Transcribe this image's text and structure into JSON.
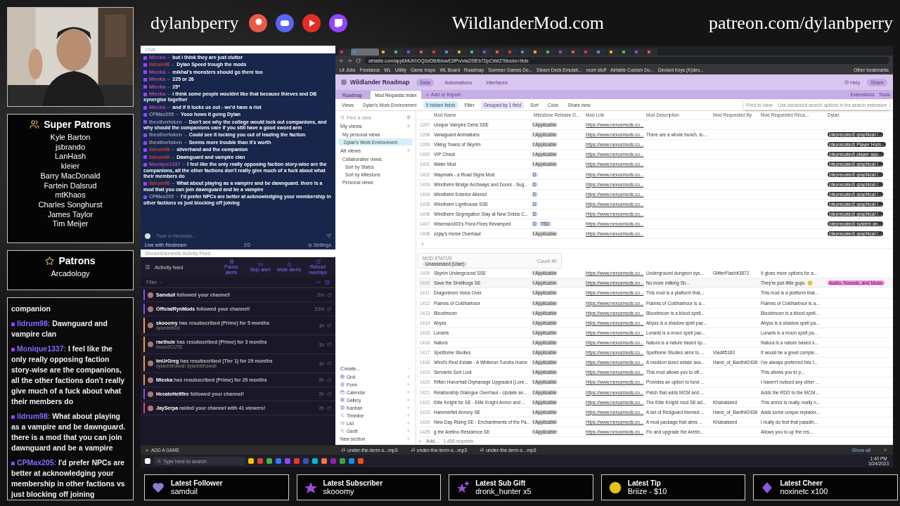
{
  "super_patrons": {
    "title": "Super Patrons",
    "names": [
      "Kyle Barton",
      "jsbrando",
      "LanHash",
      "kleier",
      "Barry MacDonald",
      "Fartein Dalsrud",
      "mtKhaos",
      "Charles Songhurst",
      "James Taylor",
      "Tim Meijer"
    ]
  },
  "patrons": {
    "title": "Patrons",
    "names": [
      "Arcadology"
    ]
  },
  "overlay_chat": [
    {
      "text": "companion"
    },
    {
      "user": "lldrum98:",
      "text": "Dawnguard and vampire clan"
    },
    {
      "user": "Monique1337:",
      "text": "I feel like the only really opposing faction story-wise are the companions, all the other factions don't really give much of a fuck about what their members do"
    },
    {
      "user": "lldrum98:",
      "text": "What about playing as a vampire and be dawnguard. there is a mod that you can join dawnguard and be a vampire"
    },
    {
      "user": "CPMax205:",
      "text": "I'd prefer NPCs are better at acknowledging your membership in other factions vs just blocking off joining"
    }
  ],
  "header": {
    "channel": "dylanbperry",
    "site": "WildlanderMod.com",
    "patreon": "patreon.com/dylanbperry",
    "socials": [
      {
        "kind": "patreon"
      },
      {
        "kind": "discord"
      },
      {
        "kind": "youtube"
      },
      {
        "kind": "twitch"
      }
    ]
  },
  "restream": {
    "title": "Chat",
    "messages": [
      {
        "user": "Mieeka",
        "color": "#b04aa0",
        "text": "but i think they are just clutter"
      },
      {
        "user": "lldrum98",
        "color": "#d23c3c",
        "text": "Dylan Speed trough the mods"
      },
      {
        "user": "Mieeka",
        "color": "#b04aa0",
        "text": "mikhal's monsters should go there too"
      },
      {
        "user": "Mieeka",
        "color": "#b04aa0",
        "text": "225 or 26"
      },
      {
        "user": "Mieeka",
        "color": "#b04aa0",
        "text": "25*"
      },
      {
        "user": "Mieeka",
        "color": "#b04aa0",
        "text": "i think some people wouldnt like that because thieves and DB synergise together"
      },
      {
        "user": "Mieeka",
        "color": "#b04aa0",
        "text": "and if it locks us out - we'd have a riot"
      },
      {
        "user": "CPMax205",
        "color": "#9a9ab0",
        "text": "Yooo hows it going Dylan"
      },
      {
        "user": "theothertoken",
        "color": "#9a9ab0",
        "text": "Don't see why the college would lock out companions, and why should the companions care if you still have a good sword arm"
      },
      {
        "user": "theothertoken",
        "color": "#9a9ab0",
        "text": "Could see it locking you out of leading the faction"
      },
      {
        "user": "theothertoken",
        "color": "#9a9ab0",
        "text": "Seems more trouble than it's worth"
      },
      {
        "user": "lldrum98",
        "color": "#d23c3c",
        "text": "silverhand and the companion"
      },
      {
        "user": "lldrum98",
        "color": "#d23c3c",
        "text": "Dawnguard and vampire clan"
      },
      {
        "user": "Monique1337",
        "color": "#b04aa0",
        "text": "I feel like the only really opposing faction story-wise are the companions, all the other factions don't really give much of a fuck about what their members do"
      },
      {
        "user": "lldrum98",
        "color": "#d23c3c",
        "text": "What about playing as a vampire and be dawnguard. there is a mod that you can join dawnguard and be a vampire"
      },
      {
        "user": "CPMax205",
        "color": "#9a9ab0",
        "text": "I'd prefer NPCs are better at acknowledging your membership in other factions vs just blocking off joining"
      }
    ],
    "placeholder": "Type a message...",
    "live": "Live with Restream",
    "count": "2/2",
    "settings": "Settings"
  },
  "activity": {
    "window_title": "StreamElements Activity Feed",
    "title": "Activity feed",
    "actions": [
      "Pause alerts",
      "Skip alert",
      "Mute alerts",
      "Reload overlays"
    ],
    "filter": "Filter",
    "items": [
      {
        "user": "Samduil",
        "text": "followed your channel!",
        "time": "2m",
        "color": "#9146ff"
      },
      {
        "user": "OfficialRynMods",
        "text": "followed your channel!",
        "time": "53m",
        "color": "#9146ff"
      },
      {
        "user": "skooomy",
        "text": "has resubscribed (Prime) for 5 months",
        "sub": "dylanb6Kiol",
        "time": "1h",
        "color": "#e8a33c"
      },
      {
        "user": "raethule",
        "text": "has resubscribed (Prime) for 3 months",
        "sub": "moon2CUTE",
        "time": "1h",
        "color": "#e8a33c"
      },
      {
        "user": "ImUrGreg",
        "text": "has resubscribed (Tier 1) for 29 months",
        "sub": "dylanb6Kawaii dylanb6Kawaii",
        "time": "1h",
        "color": "#e8a33c"
      },
      {
        "user": "Mieeka",
        "text": "has resubscribed (Prime) for 26 months",
        "time": "2h",
        "color": "#e8a33c"
      },
      {
        "user": "HecateHellfire",
        "text": "followed your channel!",
        "time": "2h",
        "color": "#9146ff"
      },
      {
        "user": "JaySerpa",
        "text": "raided your channel with 41 viewers!",
        "time": "2h",
        "color": "#e0457b"
      }
    ],
    "add_game": "ADD A GAME"
  },
  "browser": {
    "tabs": [
      {
        "selected": false
      },
      {
        "selected": true
      },
      {
        "selected": false
      },
      {
        "selected": false
      },
      {
        "selected": false
      },
      {
        "selected": false
      },
      {
        "selected": false
      },
      {
        "selected": false
      },
      {
        "selected": false
      },
      {
        "selected": false
      },
      {
        "selected": false
      },
      {
        "selected": false
      },
      {
        "selected": false
      },
      {
        "selected": false
      },
      {
        "selected": false
      },
      {
        "selected": false
      },
      {
        "selected": false
      },
      {
        "selected": false
      },
      {
        "selected": false
      },
      {
        "selected": false
      },
      {
        "selected": false
      },
      {
        "selected": false
      },
      {
        "selected": false
      },
      {
        "selected": false
      }
    ],
    "address": "airtable.com/app6MUKhDQSdDB/tbluwE3fPn/viw2SfEb7DpCbMZ?blocks=hide",
    "bookmarks": [
      "Lit Jobs",
      "Freelance",
      "WL",
      "Utility",
      "Game Inspo",
      "WL Board",
      "Roadmap",
      "Summer Games Do...",
      "Steam Deck Emulati...",
      "room stuff",
      "Airtable Custom Do...",
      "Deviant Keys (K)dev..."
    ],
    "other_bookmarks": "Other bookmarks"
  },
  "airtable": {
    "base": "Wildlander Roadmap",
    "nav": [
      {
        "label": "Data",
        "selected": true
      },
      {
        "label": "Automations",
        "selected": false
      },
      {
        "label": "Interfaces",
        "selected": false
      }
    ],
    "help": "Help",
    "share": "Share",
    "tables": [
      {
        "label": "Roadmap",
        "selected": false
      },
      {
        "label": "Mod Requests Index",
        "selected": true
      }
    ],
    "add_import": "Add or import",
    "extensions": "Extensions",
    "tools": "Tools",
    "toolbar": [
      {
        "label": "Views",
        "kind": "plain"
      },
      {
        "label": "Dylan's Work Environment",
        "kind": "view"
      },
      {
        "label": "5 hidden fields",
        "kind": "active"
      },
      {
        "label": "Filter",
        "kind": "plain"
      },
      {
        "label": "Grouped by 1 field",
        "kind": "grouped"
      },
      {
        "label": "Sort",
        "kind": "plain"
      },
      {
        "label": "Color",
        "kind": "plain"
      },
      {
        "label": "Share view",
        "kind": "plain"
      }
    ],
    "sidebar": {
      "search": "Find a view",
      "my_views": "My views",
      "personal_group": "My personal views",
      "current_view": "Dylan's Work Environment",
      "all_views": "All views",
      "collab_group": "Collaborative views",
      "collab": [
        "Sort by Status",
        "Sort by Milestone"
      ],
      "personal_views": "Personal views",
      "create": "Create...",
      "create_items": [
        "Grid",
        "Form",
        "Calendar",
        "Gallery",
        "Kanban",
        "Timeline",
        "List",
        "Gantt"
      ],
      "new_section": "New section"
    },
    "find": {
      "title": "Find in view",
      "hint": "Use advanced search options in the search extension"
    },
    "columns": [
      "Mod Name",
      "Milestone Release D...",
      "Mod Link",
      "Mod Description",
      "Mod Requested By",
      "Mod Requested Reca...",
      "Dylan"
    ],
    "top_rows": [
      {
        "number": "1397",
        "mod_name": "Unique Vampire Dens SSE",
        "milestone": [
          {
            "text": "t Applicable",
            "color": "#e0e0e0"
          }
        ],
        "mod_link": "https://www.nexusmods.co..."
      },
      {
        "number": "1398",
        "mod_name": "Vanaguard Animations",
        "milestone": [
          {
            "text": "t Applicable",
            "color": "#e0e0e0"
          }
        ],
        "mod_link": "https://www.nexusmods.co...",
        "description": "There are a whole bunch, lo...",
        "dylan": "(deprecated) graphical /..."
      },
      {
        "number": "1399",
        "mod_name": "Viking Towns of Skyrim",
        "milestone": [
          {
            "text": "t Applicable",
            "color": "#e0e0e0"
          }
        ],
        "mod_link": "https://www.nexusmods.co...",
        "dylan": "(deprecated) Player Hom..."
      },
      {
        "number": "1400",
        "mod_name": "VIP Check",
        "milestone": [
          {
            "text": "t Applicable",
            "color": "#e0e0e0"
          }
        ],
        "mod_link": "https://www.nexusmods.co...",
        "dylan": "(deprecated) player app..."
      },
      {
        "number": "1401",
        "mod_name": "Water Mod",
        "milestone": [
          {
            "text": "t Applicable",
            "color": "#e0e0e0"
          }
        ],
        "mod_link": "https://www.nexusmods.co...",
        "dylan": "(deprecated) graphical /..."
      },
      {
        "number": "1402",
        "mod_name": "Waymark - a Road Signs Mod",
        "milestone": [
          {
            "text": "D",
            "color": "#cfe0fc"
          }
        ],
        "mod_link": "https://www.nexusmods.co...",
        "dylan": "(deprecated) graphical /..."
      },
      {
        "number": "1403",
        "mod_name": "Windhelm Bridge Archways and Doors - Sug...",
        "milestone": [
          {
            "text": "D",
            "color": "#cfe0fc"
          }
        ],
        "mod_link": "https://www.nexusmods.co...",
        "dylan": "(deprecated) graphical /..."
      },
      {
        "number": "1404",
        "mod_name": "Windhelm Exterior Altered",
        "milestone": [
          {
            "text": "D",
            "color": "#cfe0fc"
          }
        ],
        "mod_link": "https://www.nexusmods.co...",
        "dylan": "(deprecated) graphical /..."
      },
      {
        "number": "1405",
        "mod_name": "Windhelm Lighthouse SSE",
        "milestone": [
          {
            "text": "D",
            "color": "#cfe0fc"
          }
        ],
        "mod_link": "https://www.nexusmods.co...",
        "dylan": "(deprecated) graphical /..."
      },
      {
        "number": "1406",
        "mod_name": "Windhelm Segregation Stay at New Gnisis C...",
        "milestone": [
          {
            "text": "D",
            "color": "#cfe0fc"
          }
        ],
        "mod_link": "https://www.nexusmods.co...",
        "dylan": "(deprecated) graphical /..."
      },
      {
        "number": "1407",
        "mod_name": "Wiseman303's Flora Fixes Revamped",
        "milestone": [
          {
            "text": "D",
            "color": "#cfe0fc"
          },
          {
            "text": "TBD",
            "color": "#cfe0fc"
          }
        ],
        "mod_link": "https://www.nexusmods.co...",
        "dylan": "(deprecated) system an..."
      },
      {
        "number": "1408",
        "mod_name": "zzjay's Horse Overhaul",
        "milestone": [
          {
            "text": "t Applicable",
            "color": "#e0e0e0"
          }
        ],
        "mod_link": "https://www.nexusmods.co...",
        "dylan": "(deprecated) graphical /..."
      }
    ],
    "group": {
      "field": "MOD STATUS",
      "value": "Unassessed (User)",
      "count": "Count 40"
    },
    "group_rows": [
      {
        "number": "1409",
        "mod_name": "Skyrim Underground SSE",
        "milestone": [
          {
            "text": "t Applicable",
            "color": "#e0e0e0"
          }
        ],
        "mod_link": "https://www.nexusmods.co...",
        "description": "Underground dungeon sys...",
        "requested_by": "GlitterFlash#3872",
        "recap": "It gives more options for a..."
      },
      {
        "number": "1410",
        "mod_name": "Save the Shellbugs SE",
        "milestone": [
          {
            "text": "t Applicable",
            "color": "#e0e0e0"
          }
        ],
        "mod_link": "https://www.nexusmods.co...",
        "description": "No more milking Sh...",
        "recap": "They're just little guys. 🙂",
        "dylan_tag": "Audio, Sounds, and Music"
      },
      {
        "number": "1411",
        "mod_name": "Dragonborn Voice Over",
        "milestone": [
          {
            "text": "t Applicable",
            "color": "#e0e0e0"
          }
        ],
        "mod_link": "https://www.nexusmods.co...",
        "description": "This mod is a platform that...",
        "recap": "This mod is a platform that..."
      },
      {
        "number": "1412",
        "mod_name": "Flames of Coldharbour",
        "milestone": [
          {
            "text": "t Applicable",
            "color": "#e0e0e0"
          }
        ],
        "mod_link": "https://www.nexusmods.co...",
        "description": "Flames of Coldharbour is a...",
        "recap": "Flames of Coldharbour is a..."
      },
      {
        "number": "1413",
        "mod_name": "Bloodmoon",
        "milestone": [
          {
            "text": "t Applicable",
            "color": "#e0e0e0"
          }
        ],
        "mod_link": "https://www.nexusmods.co...",
        "description": "Bloodmoon is a blood spell...",
        "recap": "Bloodmoon is a blood spell..."
      },
      {
        "number": "1414",
        "mod_name": "Abyss",
        "milestone": [
          {
            "text": "t Applicable",
            "color": "#e0e0e0"
          }
        ],
        "mod_link": "https://www.nexusmods.co...",
        "description": "Abyss is a shadow spell pac...",
        "recap": "Abyss is a shadow spell pa..."
      },
      {
        "number": "1415",
        "mod_name": "Lunaris",
        "milestone": [
          {
            "text": "t Applicable",
            "color": "#e0e0e0"
          }
        ],
        "mod_link": "https://www.nexusmods.co...",
        "description": "Lunaris is a moon spell pac...",
        "recap": "Lunaris is a moon spell pa..."
      },
      {
        "number": "1416",
        "mod_name": "Natura",
        "milestone": [
          {
            "text": "t Applicable",
            "color": "#e0e0e0"
          }
        ],
        "mod_link": "https://www.nexusmods.co...",
        "description": "Natura is a nature based sp...",
        "recap": "Natura is a nature based s..."
      },
      {
        "number": "1417",
        "mod_name": "Spelltome Studies",
        "milestone": [
          {
            "text": "t Applicable",
            "color": "#e0e0e0"
          }
        ],
        "mod_link": "https://www.nexusmods.co...",
        "description": "Spelltome Studies aims to ...",
        "requested_by": "Vlad#5160",
        "recap": "It would be a great comple..."
      },
      {
        "number": "1418",
        "mod_name": "Wind's Rest Estate - A Whiterun Tundra Home",
        "milestone": [
          {
            "text": "t Applicable",
            "color": "#e0e0e0"
          }
        ],
        "mod_link": "https://www.nexusmods.co...",
        "description": "A medium sized estate ava...",
        "requested_by": "Hand_of_Banth#2436",
        "recap": "I've always preferred this t..."
      },
      {
        "number": "1419",
        "mod_name": "Servants Sort Loot",
        "milestone": [
          {
            "text": "t Applicable",
            "color": "#e0e0e0"
          }
        ],
        "mod_link": "https://www.nexusmods.co...",
        "description": "This mod allows you to off...",
        "recap": "This allows you to p..."
      },
      {
        "number": "1420",
        "mod_name": "Riften Honorhall Orphanage Upgraded (Lore...",
        "milestone": [
          {
            "text": "t Applicable",
            "color": "#e0e0e0"
          }
        ],
        "mod_link": "https://www.nexusmods.co...",
        "description": "Provides an option to fund ...",
        "recap": "I haven't noticed any other ..."
      },
      {
        "number": "1421",
        "mod_name": "Relationship Dialogue Overhaul - Update an...",
        "milestone": [
          {
            "text": "t Applicable",
            "color": "#e0e0e0"
          }
        ],
        "mod_link": "https://www.nexusmods.co...",
        "description": "Patch that adds MCM and ...",
        "recap": "Adds the RDO to the MCM..."
      },
      {
        "number": "1422",
        "mod_name": "Elite Knight for SE - Elite Knight Armor and ...",
        "milestone": [
          {
            "text": "t Applicable",
            "color": "#e0e0e0"
          }
        ],
        "mod_link": "https://www.nexusmods.co...",
        "description": "The Elite Knight mod SE ad...",
        "requested_by": "Khabalseed",
        "recap": "This armor is really, really n..."
      },
      {
        "number": "1423",
        "mod_name": "Hammerfell Armory SE",
        "milestone": [
          {
            "text": "t Applicable",
            "color": "#e0e0e0"
          }
        ],
        "mod_link": "https://www.nexusmods.co...",
        "description": "A set of Redguard themed ...",
        "requested_by": "Hand_of_Banth#2436",
        "recap": "Adds some unique replacer..."
      },
      {
        "number": "1424",
        "mod_name": "New Day Rising SE - Enchantments of the Pa...",
        "milestone": [
          {
            "text": "t Applicable",
            "color": "#e0e0e0"
          }
        ],
        "mod_link": "https://www.nexusmods.co...",
        "description": "A mod package that aims ...",
        "requested_by": "Khabalseed",
        "recap": "I really do feel that paladin..."
      },
      {
        "number": "1425",
        "mod_name": "g the Aretino Residence SE",
        "milestone": [
          {
            "text": "t Applicable",
            "color": "#e0e0e0"
          }
        ],
        "mod_link": "https://www.nexusmods.co...",
        "description": "Fix and upgrade the Aretin...",
        "recap": "Allows you to up the res..."
      }
    ],
    "add_label": "Add...",
    "records": "1,458 requests"
  },
  "taskbar": {
    "search": "Type here to search",
    "downloads": [
      "under-the-term-s...mp3",
      "under-the-term-s...mp3",
      "under-the-term-s...mp3"
    ],
    "show_all": "Show all",
    "time": "1:40 PM",
    "date": "3/24/2023"
  },
  "alerts": [
    {
      "kind": "heart",
      "title": "Latest Follower",
      "value": "samduil"
    },
    {
      "kind": "star",
      "title": "Latest Subscriber",
      "value": "skooomy"
    },
    {
      "kind": "stars",
      "title": "Latest Sub Gift",
      "value": "dronk_hunter x5"
    },
    {
      "kind": "coin",
      "title": "Latest Tip",
      "value": "Briize - $10"
    },
    {
      "kind": "gem",
      "title": "Latest Cheer",
      "value": "noxinetc x100"
    }
  ]
}
